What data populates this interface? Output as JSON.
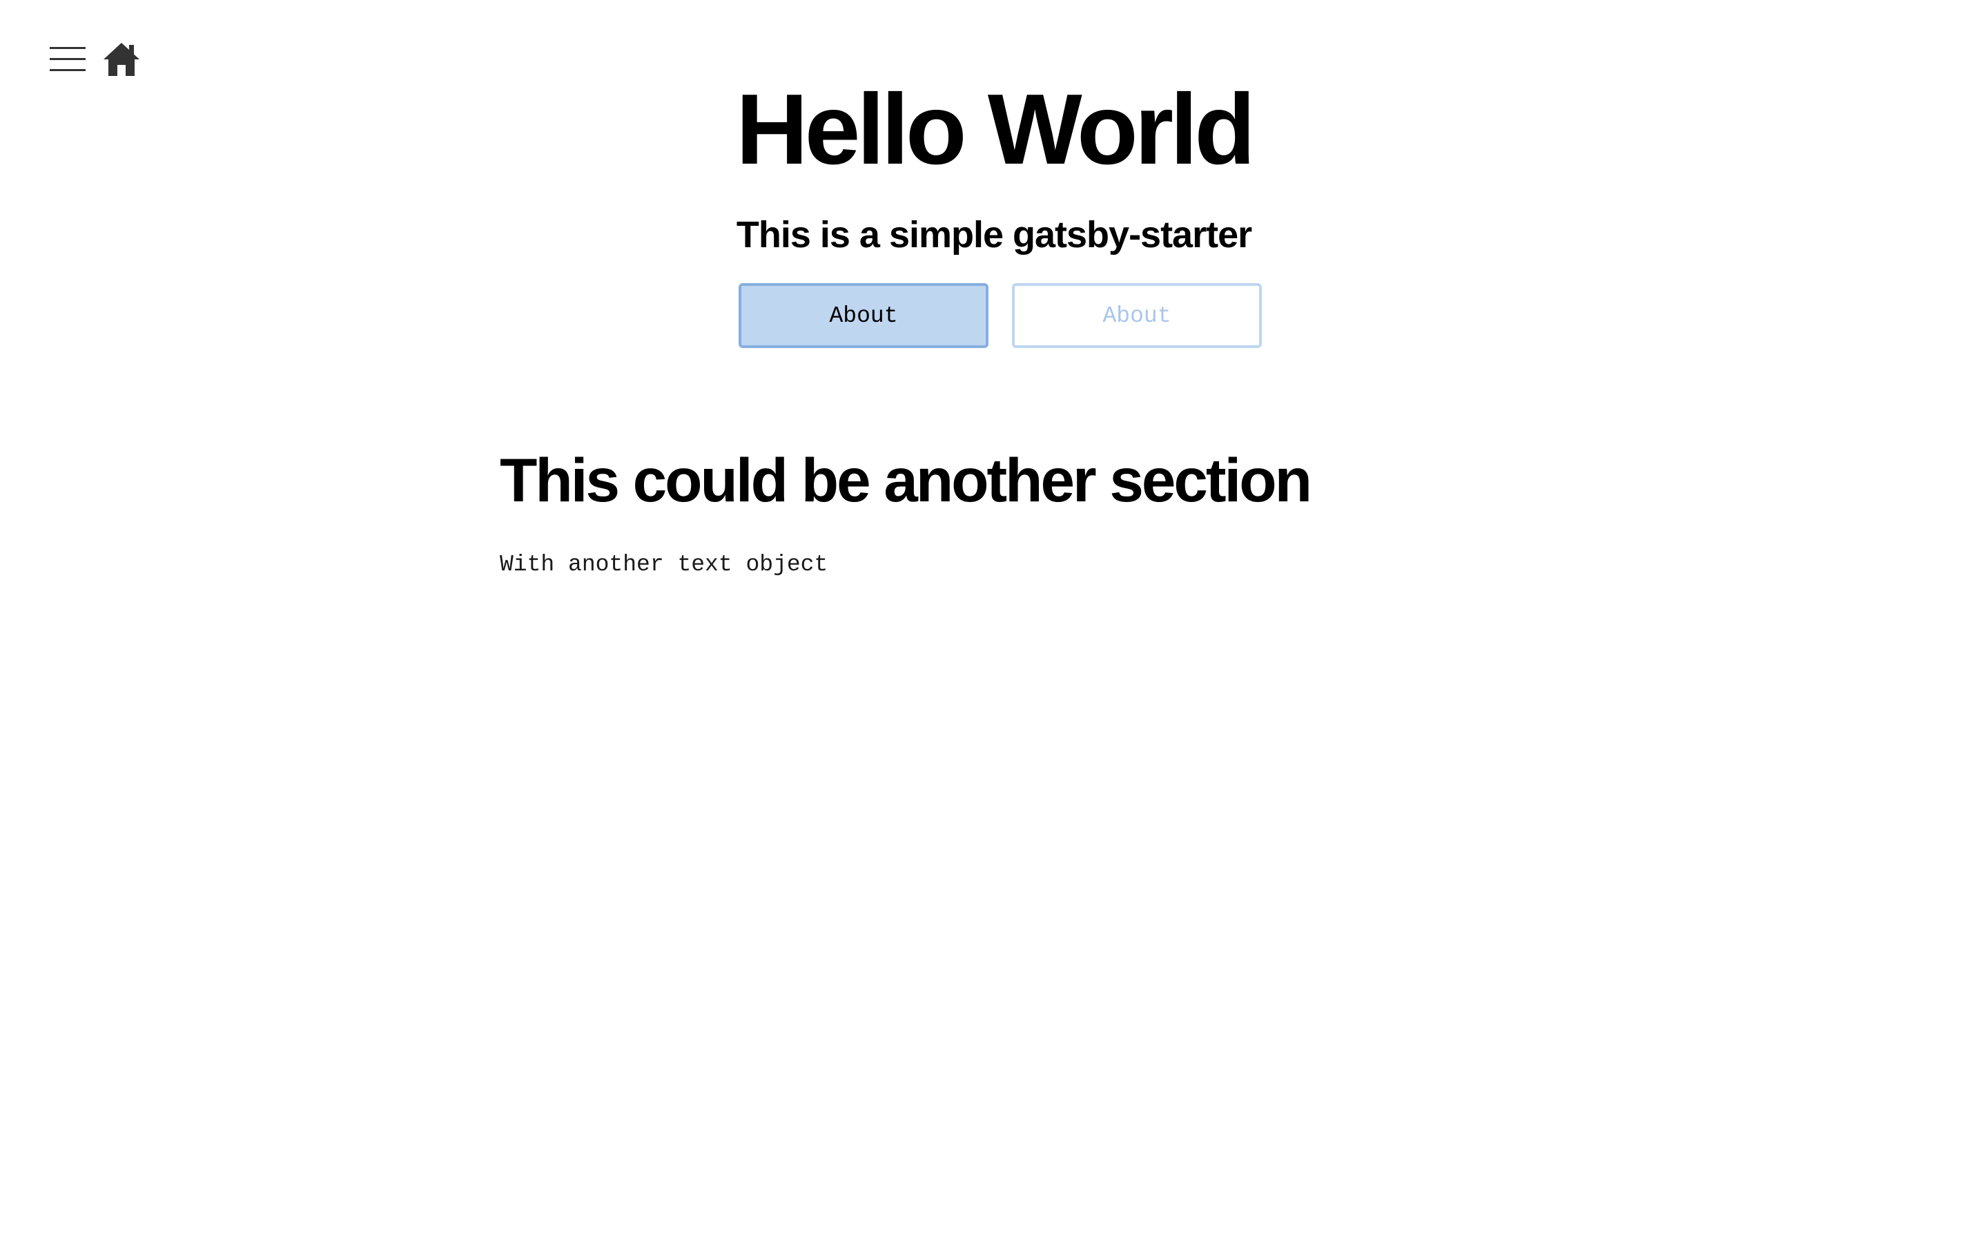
{
  "nav": {
    "menu_icon": "hamburger-menu-icon",
    "home_icon": "home-icon"
  },
  "hero": {
    "title": "Hello World",
    "subtitle": "This is a simple gatsby-starter",
    "buttons": [
      {
        "label": "About",
        "style": "filled"
      },
      {
        "label": "About",
        "style": "outline"
      }
    ]
  },
  "section": {
    "title": "This could be another section",
    "text": "With another text object"
  },
  "colors": {
    "primary_fill": "#bfd6f1",
    "primary_border": "#86aedf",
    "outline_text": "#a9c6ea",
    "icon": "#333333"
  }
}
